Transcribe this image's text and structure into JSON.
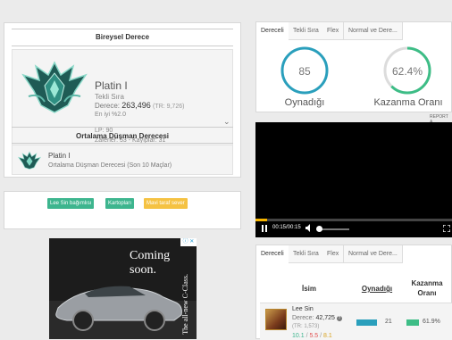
{
  "left": {
    "individual_rank": {
      "title": "Bireysel Derece",
      "tier": "Platin I",
      "queue": "Tekli Sıra",
      "rank_label": "Derece:",
      "rank_value": "263,496",
      "rank_tr": "(TR: 9,726)",
      "top_percent": "En iyi %2.0",
      "lp": "LP: 90",
      "record": "Zaferler: 53 - Kayıplar: 31"
    },
    "avg_opponent": {
      "title": "Ortalama Düşman Derecesi",
      "tier": "Platin I",
      "desc": "Ortalama Düşman Derecesi (Son 10 Maçlar)"
    },
    "tags": [
      {
        "label": "Lee Sin bağımlısı",
        "color": "#3db58e"
      },
      {
        "label": "Kartopları",
        "color": "#3db58e"
      },
      {
        "label": "Mavi taraf sever",
        "color": "#f5c242"
      }
    ],
    "ad": {
      "headline": "Coming soon.",
      "side_text": "The all-new C-Class.",
      "ad_icons": "ⓘ ✕"
    }
  },
  "stats": {
    "tabs": [
      "Dereceli",
      "Tekli Sıra",
      "Flex",
      "Normal ve Dere..."
    ],
    "games": {
      "value": "85",
      "label": "Oynadığı",
      "color": "#2a9fbc"
    },
    "winrate": {
      "value": "62.4%",
      "label": "Kazanma Oranı",
      "percent": 62.4,
      "color": "#3dbd86"
    }
  },
  "report_label": "REPORT A",
  "video": {
    "time": "00:15/00:15",
    "progress": 0.06,
    "volume": 0.0
  },
  "table": {
    "tabs": [
      "Dereceli",
      "Tekli Sıra",
      "Flex",
      "Normal ve Dere..."
    ],
    "headers": {
      "name": "İsim",
      "played": "Oynadığı",
      "winrate_line1": "Kazanma",
      "winrate_line2": "Oranı"
    },
    "rows": [
      {
        "champion": "Lee Sin",
        "rank_label": "Derece:",
        "rank_value": "42,725",
        "rank_tr": "(TR: 1,573)",
        "kda_k": "10.1",
        "kda_d": "5.5",
        "kda_a": "8.1",
        "games": "21",
        "games_ratio": 0.72,
        "winrate": "61.9%",
        "winrate_ratio": 0.62
      }
    ]
  }
}
